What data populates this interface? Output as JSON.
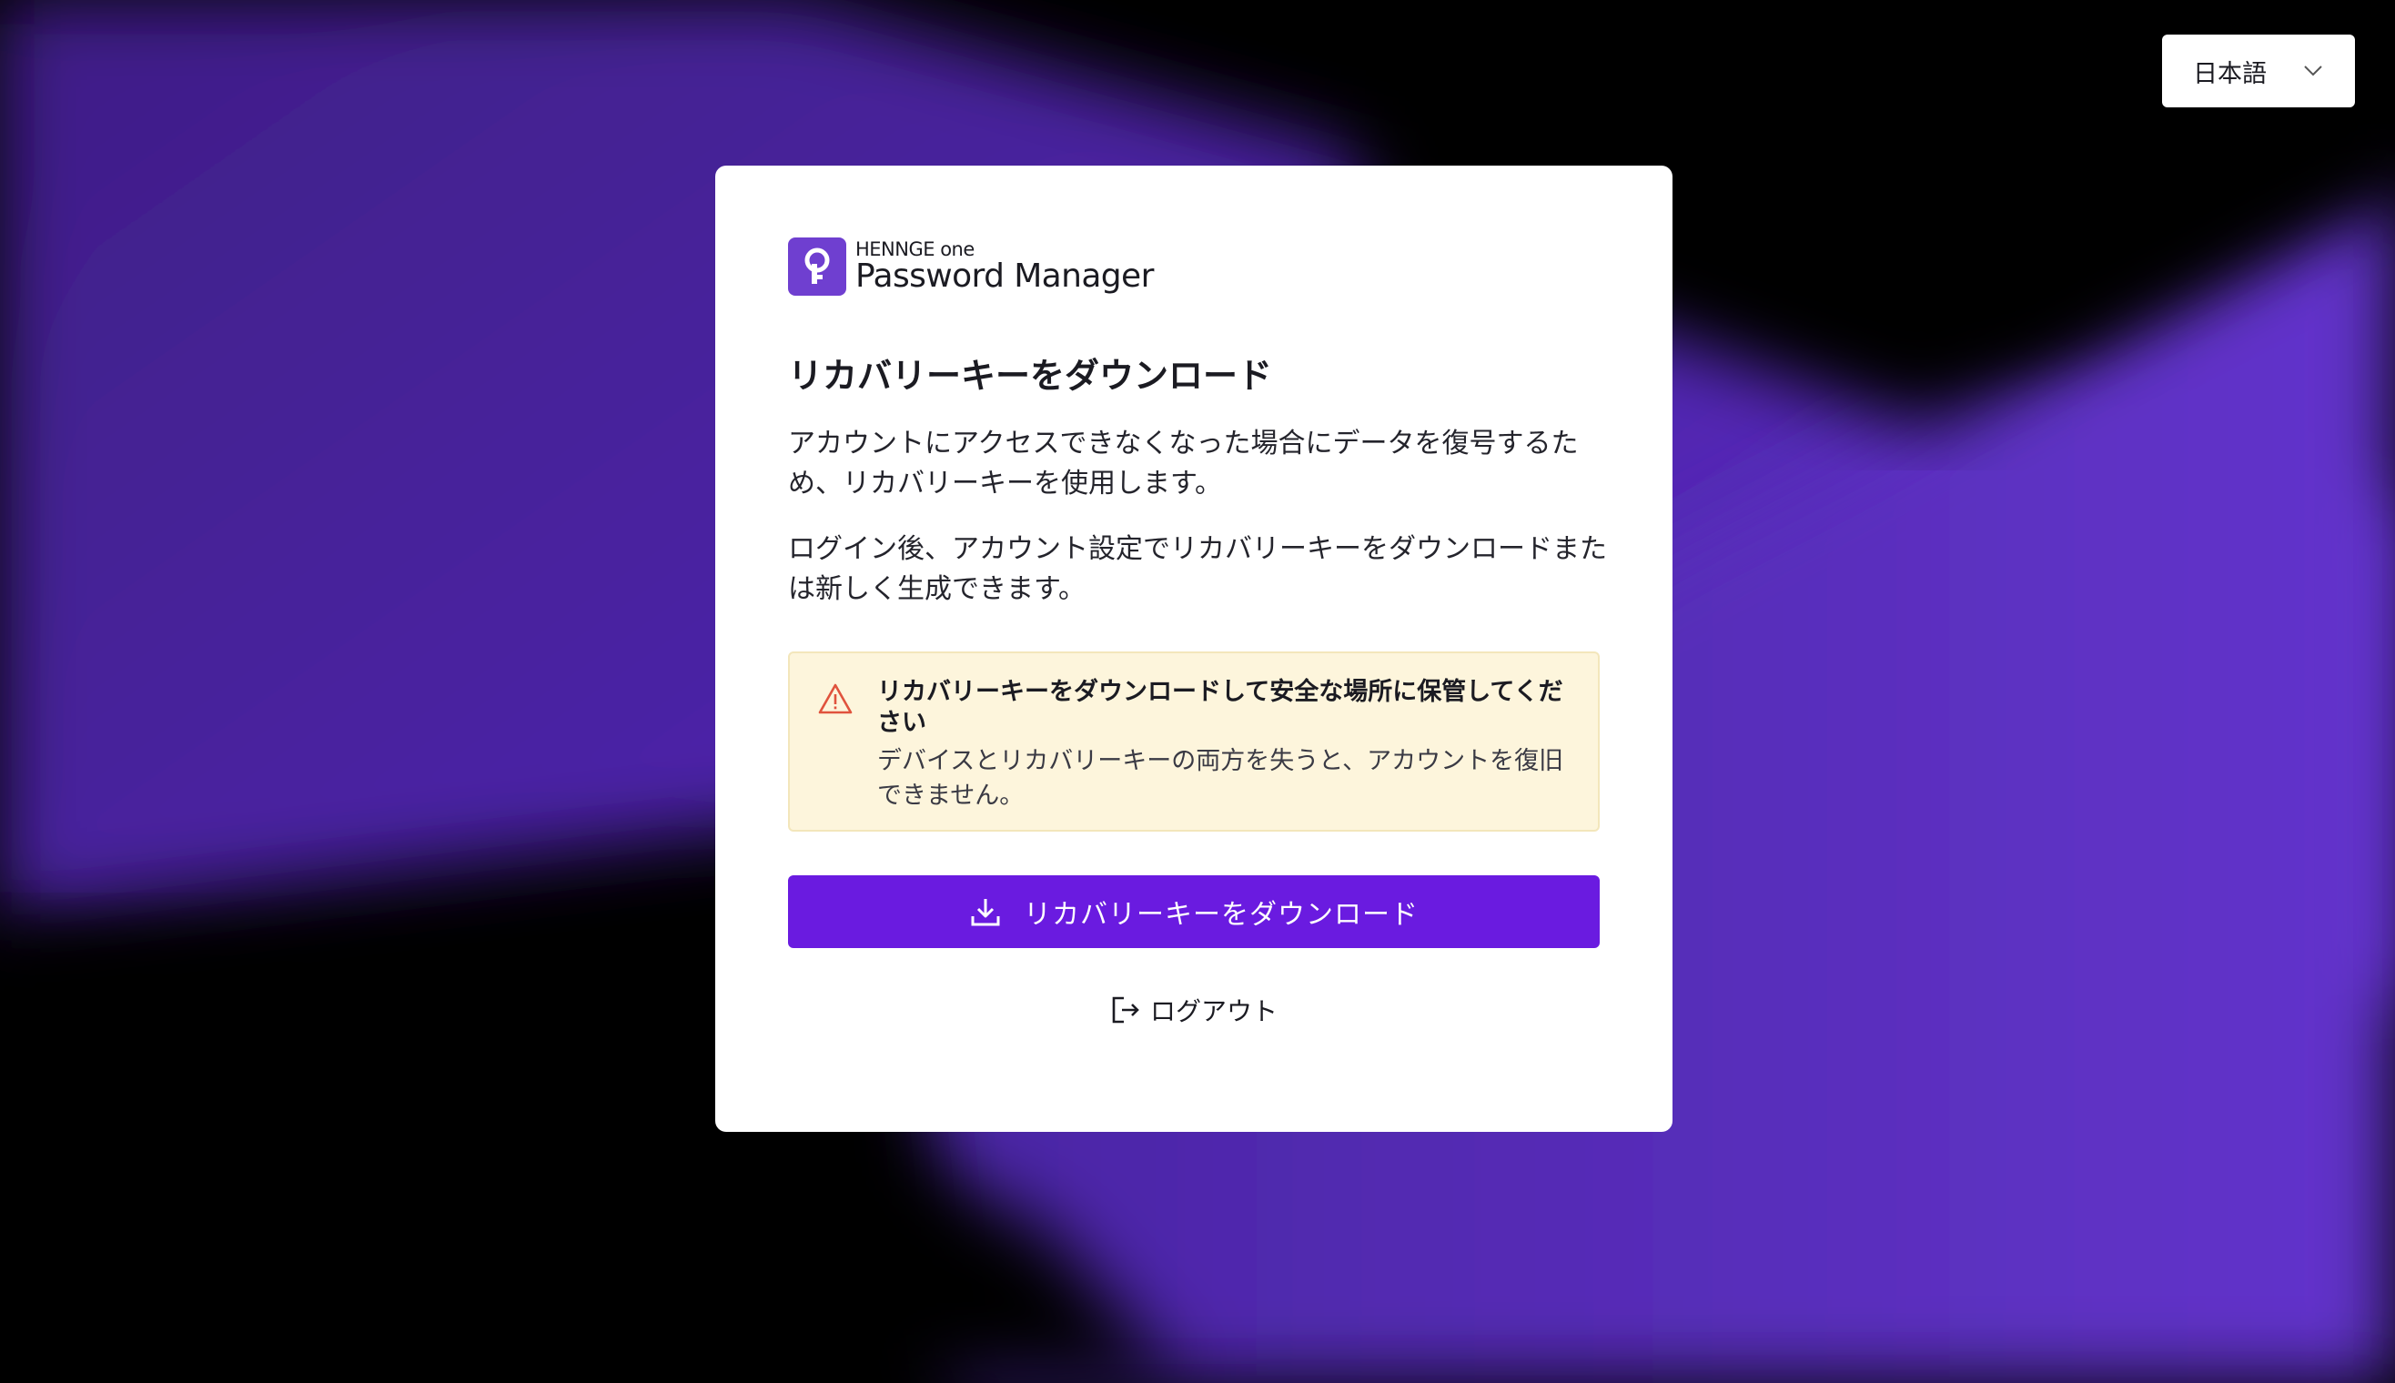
{
  "language_selector": {
    "value": "日本語"
  },
  "card": {
    "logo": {
      "brand": "HENNGE one",
      "product": "Password Manager"
    },
    "title": "リカバリーキーをダウンロード",
    "paragraph_1": "アカウントにアクセスできなくなった場合にデータを復号するため、リカバリーキーを使用します。",
    "paragraph_2": "ログイン後、アカウント設定でリカバリーキーをダウンロードまたは新しく生成できます。",
    "warning": {
      "title": "リカバリーキーをダウンロードして安全な場所に保管してください",
      "text": "デバイスとリカバリーキーの両方を失うと、アカウントを復旧できません。"
    },
    "download_button": {
      "label": "リカバリーキーをダウンロード"
    },
    "logout_link": {
      "label": "ログアウト"
    }
  },
  "colors": {
    "accent": "#6a1be0",
    "logo_mark": "#6f3fd0",
    "warning_background": "#fdf5dc",
    "warning_icon": "#e0533d",
    "background_purple": "#5b2bc4"
  },
  "icons": {
    "language_chevron": "chevron-down-icon",
    "logo": "key-icon",
    "warning": "warning-triangle-icon",
    "download": "download-icon",
    "logout": "logout-icon"
  }
}
